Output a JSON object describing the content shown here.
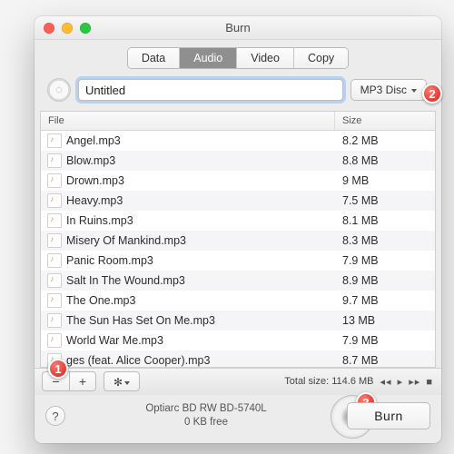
{
  "window": {
    "title": "Burn"
  },
  "tabs": [
    {
      "label": "Data",
      "active": false
    },
    {
      "label": "Audio",
      "active": true
    },
    {
      "label": "Video",
      "active": false
    },
    {
      "label": "Copy",
      "active": false
    }
  ],
  "disc": {
    "name_value": "Untitled",
    "type_label": "MP3 Disc"
  },
  "columns": {
    "file": "File",
    "size": "Size"
  },
  "files": [
    {
      "name": "Angel.mp3",
      "size": "8.2 MB"
    },
    {
      "name": "Blow.mp3",
      "size": "8.8 MB"
    },
    {
      "name": "Drown.mp3",
      "size": "9 MB"
    },
    {
      "name": "Heavy.mp3",
      "size": "7.5 MB"
    },
    {
      "name": "In Ruins.mp3",
      "size": "8.1 MB"
    },
    {
      "name": "Misery Of Mankind.mp3",
      "size": "8.3 MB"
    },
    {
      "name": "Panic Room.mp3",
      "size": "7.9 MB"
    },
    {
      "name": "Salt In The Wound.mp3",
      "size": "8.9 MB"
    },
    {
      "name": "The One.mp3",
      "size": "9.7 MB"
    },
    {
      "name": "The Sun Has Set On Me.mp3",
      "size": "13 MB"
    },
    {
      "name": "World War Me.mp3",
      "size": "7.9 MB"
    },
    {
      "name": "ges (feat. Alice Cooper).mp3",
      "size": "8.7 MB"
    }
  ],
  "toolbar": {
    "remove_label": "−",
    "add_label": "+",
    "total_size_label": "Total size:",
    "total_size_value": "114.6 MB"
  },
  "footer": {
    "help_label": "?",
    "drive_name": "Optiarc BD RW BD-5740L",
    "drive_free": "0 KB free",
    "burn_label": "Burn"
  },
  "callouts": {
    "one": "1",
    "two": "2",
    "three": "3"
  }
}
